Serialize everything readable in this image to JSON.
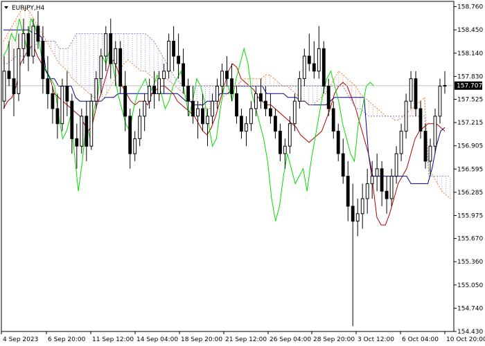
{
  "chart_data": {
    "type": "candlestick",
    "symbol": "EURJPY,H4",
    "title": "",
    "current_price": "157.707",
    "ylim": [
      154.43,
      158.83
    ],
    "y_ticks": [
      "158.760",
      "158.450",
      "158.140",
      "157.830",
      "157.525",
      "157.215",
      "156.905",
      "156.595",
      "156.285",
      "155.975",
      "155.670",
      "155.360",
      "155.050",
      "154.740",
      "154.430"
    ],
    "x_ticks": [
      "4 Sep 2023",
      "6 Sep 20:00",
      "11 Sep 12:00",
      "14 Sep 04:00",
      "18 Sep 20:00",
      "21 Sep 12:00",
      "26 Sep 04:00",
      "28 Sep 20:00",
      "3 Oct 12:00",
      "6 Oct 04:00",
      "10 Oct 20:00"
    ],
    "series": [
      {
        "name": "",
        "role": "tenkan",
        "color": "#b00000",
        "values": [
          157.4,
          157.5,
          157.55,
          157.7,
          158.0,
          158.1,
          158.2,
          158.25,
          158.1,
          158.0,
          157.9,
          157.8,
          157.6,
          157.55,
          157.5,
          157.45,
          157.4,
          157.35,
          157.3,
          157.2,
          157.1,
          157.2,
          157.45,
          157.6,
          157.8,
          158.0,
          158.05,
          157.9,
          157.7,
          157.6,
          157.5,
          157.45,
          157.5,
          157.5,
          157.45,
          157.6,
          157.65,
          157.7,
          157.7,
          157.65,
          157.6,
          157.5,
          157.45,
          157.4,
          157.35,
          157.3,
          157.2,
          157.1,
          157.05,
          157.15,
          157.3,
          157.5,
          157.7,
          157.9,
          158.0,
          157.95,
          157.8,
          157.75,
          157.7,
          157.65,
          157.55,
          157.5,
          157.45,
          157.45,
          157.4,
          157.35,
          157.3,
          157.25,
          157.2,
          157.15,
          157.05,
          157.0,
          156.95,
          157.0,
          157.05,
          157.1,
          157.25,
          157.4,
          157.6,
          157.7,
          157.75,
          157.7,
          157.55,
          157.4,
          157.2,
          157.0,
          156.8,
          156.4,
          155.95,
          155.85,
          155.85,
          156.0,
          156.2,
          156.4,
          156.5,
          156.6,
          156.8,
          157.0,
          157.1,
          157.15,
          157.2,
          157.2,
          157.2,
          157.15,
          157.1
        ]
      },
      {
        "name": "",
        "role": "kijun",
        "color": "#000090",
        "values": [
          158.45,
          158.45,
          158.45,
          158.45,
          158.45,
          158.45,
          158.45,
          158.4,
          158.4,
          158.35,
          157.9,
          157.8,
          157.8,
          157.7,
          157.7,
          157.7,
          157.7,
          157.55,
          157.5,
          157.5,
          157.5,
          157.5,
          157.5,
          157.5,
          157.55,
          157.55,
          157.55,
          157.6,
          157.6,
          157.6,
          157.6,
          157.6,
          157.6,
          157.6,
          157.6,
          157.6,
          157.6,
          157.6,
          157.6,
          157.6,
          157.6,
          157.6,
          157.55,
          157.5,
          157.5,
          157.45,
          157.45,
          157.45,
          157.5,
          157.5,
          157.5,
          157.6,
          157.6,
          157.6,
          157.7,
          157.7,
          157.7,
          157.7,
          157.7,
          157.7,
          157.7,
          157.7,
          157.6,
          157.6,
          157.6,
          157.6,
          157.6,
          157.55,
          157.55,
          157.55,
          157.5,
          157.5,
          157.45,
          157.45,
          157.45,
          157.45,
          157.45,
          157.5,
          157.55,
          157.55,
          157.55,
          157.55,
          157.55,
          157.55,
          157.55,
          157.55,
          156.8,
          156.5,
          156.5,
          156.5,
          156.5,
          156.5,
          156.5,
          156.5,
          156.5,
          156.5,
          156.4,
          156.4,
          156.4,
          156.4,
          156.4,
          156.6,
          156.9,
          157.1,
          157.15
        ]
      },
      {
        "name": "",
        "role": "chikou",
        "color": "#00dd00",
        "values": [
          158.1,
          158.2,
          158.4,
          158.3,
          158.6,
          158.4,
          158.2,
          158.6,
          158.5,
          158.3,
          158.0,
          157.9,
          157.8,
          157.7,
          157.3,
          157.0,
          157.1,
          157.3,
          156.8,
          156.3,
          156.7,
          157.2,
          157.0,
          157.4,
          157.6,
          158.1,
          158.0,
          158.2,
          157.9,
          157.6,
          157.4,
          157.2,
          157.1,
          157.4,
          157.6,
          157.7,
          157.8,
          157.6,
          157.7,
          157.85,
          157.6,
          157.4,
          157.5,
          157.7,
          157.8,
          157.9,
          157.6,
          157.3,
          157.5,
          157.8,
          157.7,
          157.5,
          157.2,
          156.9,
          157.0,
          157.4,
          157.7,
          157.7,
          157.5,
          157.8,
          158.0,
          158.2,
          158.0,
          157.6,
          157.4,
          157.2,
          157.0,
          156.7,
          156.2,
          155.9,
          156.1,
          156.5,
          156.8,
          156.6,
          156.4,
          156.5,
          156.6,
          156.3,
          156.7,
          157.0,
          157.3,
          157.6,
          157.8,
          157.9,
          157.7,
          157.5,
          157.2,
          157.0,
          156.8,
          156.7,
          157.2,
          157.4,
          157.7,
          157.75,
          157.7
        ]
      },
      {
        "name": "",
        "role": "senkou_a",
        "color": "#e88040",
        "values": [
          158.3,
          158.4,
          158.5,
          158.6,
          158.7,
          158.75,
          158.7,
          158.6,
          158.5,
          158.4,
          158.3,
          158.2,
          158.1,
          158.0,
          157.95,
          157.9,
          157.8,
          157.75,
          157.7,
          157.65,
          157.6,
          157.55,
          157.55,
          157.5,
          157.6,
          157.7,
          157.8,
          157.9,
          158.0,
          158.05,
          158.0,
          157.95,
          157.9,
          157.9,
          157.85,
          157.8,
          157.75,
          157.8,
          157.8,
          157.75,
          157.7,
          157.65,
          157.6,
          157.55,
          157.5,
          157.5,
          157.45,
          157.4,
          157.4,
          157.45,
          157.5,
          157.55,
          157.6,
          157.65,
          157.7,
          157.75,
          157.8,
          157.8,
          157.8,
          157.8,
          157.8,
          157.85,
          157.85,
          157.8,
          157.75,
          157.7,
          157.7,
          157.65,
          157.6,
          157.55,
          157.5,
          157.45,
          157.45,
          157.5,
          157.55,
          157.6,
          157.7,
          157.8,
          157.9,
          157.85,
          157.8,
          157.75,
          157.7,
          157.6,
          157.55,
          157.5,
          157.45,
          157.4,
          157.35,
          157.3,
          157.3,
          157.25,
          157.25,
          157.3,
          157.35,
          157.4,
          157.45,
          157.5,
          157.55,
          156.6,
          156.5,
          156.4,
          156.3,
          156.25,
          156.2
        ]
      },
      {
        "name": "",
        "role": "senkou_b",
        "color": "#8080c0",
        "values": [
          158.0,
          158.0,
          158.05,
          158.1,
          158.1,
          158.1,
          158.2,
          158.2,
          158.3,
          158.3,
          158.3,
          158.3,
          158.3,
          158.2,
          158.2,
          158.2,
          158.3,
          158.4,
          158.4,
          158.4,
          158.4,
          158.4,
          158.4,
          158.4,
          158.4,
          158.4,
          158.4,
          158.4,
          158.4,
          158.4,
          158.4,
          158.4,
          158.4,
          158.4,
          158.35,
          158.3,
          158.2,
          158.1,
          158.0,
          157.9,
          157.8,
          157.75,
          157.7,
          157.7,
          157.7,
          157.7,
          157.7,
          157.7,
          157.7,
          157.7,
          157.7,
          157.7,
          157.7,
          157.7,
          157.7,
          157.7,
          157.7,
          157.7,
          157.7,
          157.7,
          157.7,
          157.7,
          157.7,
          157.7,
          157.7,
          157.7,
          157.7,
          157.7,
          157.7,
          157.7,
          157.7,
          157.7,
          157.7,
          157.7,
          157.7,
          157.7,
          157.7,
          157.7,
          157.7,
          157.7,
          157.6,
          157.5,
          157.4,
          157.4,
          157.35,
          157.3,
          157.3,
          157.3,
          157.3,
          157.3,
          157.3,
          157.3,
          157.3,
          157.3,
          157.3,
          157.3,
          157.3,
          157.3,
          157.3,
          156.5,
          156.5,
          156.5,
          156.5,
          156.5,
          156.5
        ]
      }
    ],
    "candles": [
      [
        157.5,
        158.1,
        157.4,
        157.9
      ],
      [
        157.9,
        158.3,
        157.7,
        157.8
      ],
      [
        157.8,
        158.2,
        157.3,
        157.6
      ],
      [
        157.6,
        158.4,
        157.5,
        158.2
      ],
      [
        158.2,
        158.6,
        158.0,
        158.4
      ],
      [
        158.4,
        158.5,
        157.9,
        158.1
      ],
      [
        158.1,
        158.6,
        158.0,
        158.5
      ],
      [
        158.5,
        158.7,
        158.2,
        158.3
      ],
      [
        158.3,
        158.5,
        157.6,
        157.8
      ],
      [
        157.8,
        158.1,
        157.4,
        157.6
      ],
      [
        157.6,
        157.7,
        157.2,
        157.4
      ],
      [
        157.4,
        157.6,
        157.0,
        157.2
      ],
      [
        157.2,
        157.8,
        157.1,
        157.7
      ],
      [
        157.7,
        157.9,
        157.3,
        157.5
      ],
      [
        157.5,
        157.6,
        156.8,
        157.0
      ],
      [
        157.0,
        157.2,
        156.6,
        156.9
      ],
      [
        156.9,
        157.4,
        156.8,
        157.3
      ],
      [
        157.3,
        157.5,
        156.7,
        156.9
      ],
      [
        156.9,
        157.6,
        156.85,
        157.5
      ],
      [
        157.5,
        157.9,
        157.4,
        157.8
      ],
      [
        157.8,
        158.2,
        157.6,
        158.1
      ],
      [
        158.1,
        158.5,
        157.9,
        158.4
      ],
      [
        158.4,
        158.6,
        157.8,
        158.0
      ],
      [
        158.0,
        158.3,
        157.7,
        158.2
      ],
      [
        158.2,
        158.3,
        157.6,
        157.7
      ],
      [
        157.7,
        157.9,
        157.1,
        157.3
      ],
      [
        157.3,
        157.4,
        156.6,
        156.8
      ],
      [
        156.8,
        157.1,
        156.7,
        157.0
      ],
      [
        157.0,
        157.4,
        156.9,
        157.3
      ],
      [
        157.3,
        157.6,
        157.1,
        157.5
      ],
      [
        157.5,
        157.8,
        157.4,
        157.7
      ],
      [
        157.7,
        157.9,
        157.4,
        157.6
      ],
      [
        157.6,
        157.9,
        157.5,
        157.8
      ],
      [
        157.8,
        158.0,
        157.6,
        157.9
      ],
      [
        157.9,
        158.4,
        157.8,
        158.3
      ],
      [
        158.3,
        158.5,
        157.9,
        158.1
      ],
      [
        158.1,
        158.4,
        157.8,
        158.0
      ],
      [
        158.0,
        158.2,
        157.6,
        157.7
      ],
      [
        157.7,
        157.8,
        157.3,
        157.5
      ],
      [
        157.5,
        157.7,
        157.2,
        157.3
      ],
      [
        157.3,
        157.5,
        157.0,
        157.4
      ],
      [
        157.4,
        157.6,
        157.1,
        157.2
      ],
      [
        157.2,
        157.4,
        156.9,
        157.3
      ],
      [
        157.3,
        157.6,
        157.2,
        157.5
      ],
      [
        157.5,
        157.8,
        157.4,
        157.7
      ],
      [
        157.7,
        158.0,
        157.6,
        157.9
      ],
      [
        157.9,
        158.1,
        157.7,
        157.8
      ],
      [
        157.8,
        158.0,
        157.5,
        157.6
      ],
      [
        157.6,
        157.7,
        157.2,
        157.3
      ],
      [
        157.3,
        157.4,
        157.0,
        157.1
      ],
      [
        157.1,
        157.3,
        156.9,
        157.2
      ],
      [
        157.2,
        157.5,
        157.1,
        157.4
      ],
      [
        157.4,
        157.7,
        157.3,
        157.6
      ],
      [
        157.6,
        157.8,
        157.4,
        157.5
      ],
      [
        157.5,
        157.7,
        157.3,
        157.4
      ],
      [
        157.4,
        157.6,
        157.2,
        157.3
      ],
      [
        157.3,
        157.4,
        157.0,
        157.1
      ],
      [
        157.1,
        157.2,
        156.7,
        156.8
      ],
      [
        156.8,
        157.0,
        156.6,
        156.9
      ],
      [
        156.9,
        157.3,
        156.8,
        157.2
      ],
      [
        157.2,
        157.6,
        157.1,
        157.5
      ],
      [
        157.5,
        157.9,
        157.4,
        157.8
      ],
      [
        157.8,
        158.2,
        157.7,
        158.1
      ],
      [
        158.1,
        158.4,
        157.9,
        158.0
      ],
      [
        158.0,
        158.3,
        157.8,
        157.9
      ],
      [
        157.9,
        158.5,
        157.8,
        158.2
      ],
      [
        158.2,
        158.3,
        157.6,
        157.7
      ],
      [
        157.7,
        157.8,
        157.3,
        157.4
      ],
      [
        157.4,
        157.5,
        157.0,
        157.1
      ],
      [
        157.1,
        157.2,
        156.7,
        156.8
      ],
      [
        156.8,
        157.0,
        156.4,
        156.5
      ],
      [
        156.5,
        156.7,
        155.9,
        156.1
      ],
      [
        156.1,
        156.4,
        154.5,
        155.9
      ],
      [
        155.9,
        156.2,
        155.7,
        156.0
      ],
      [
        156.0,
        156.4,
        155.8,
        156.2
      ],
      [
        156.2,
        156.6,
        156.0,
        156.4
      ],
      [
        156.4,
        156.7,
        156.2,
        156.5
      ],
      [
        156.5,
        156.8,
        156.3,
        156.6
      ],
      [
        156.6,
        156.7,
        156.1,
        156.3
      ],
      [
        156.3,
        156.5,
        156.0,
        156.2
      ],
      [
        156.2,
        156.6,
        156.1,
        156.5
      ],
      [
        156.5,
        156.9,
        156.4,
        156.8
      ],
      [
        156.8,
        157.2,
        156.7,
        157.1
      ],
      [
        157.1,
        157.6,
        157.0,
        157.5
      ],
      [
        157.5,
        157.9,
        157.4,
        157.8
      ],
      [
        157.8,
        157.9,
        157.3,
        157.4
      ],
      [
        157.4,
        157.5,
        157.0,
        157.1
      ],
      [
        157.1,
        157.2,
        156.6,
        156.7
      ],
      [
        156.7,
        157.0,
        156.5,
        156.9
      ],
      [
        156.9,
        157.4,
        156.8,
        157.3
      ],
      [
        157.3,
        157.8,
        157.2,
        157.7
      ],
      [
        157.7,
        157.9,
        157.6,
        157.71
      ]
    ]
  }
}
